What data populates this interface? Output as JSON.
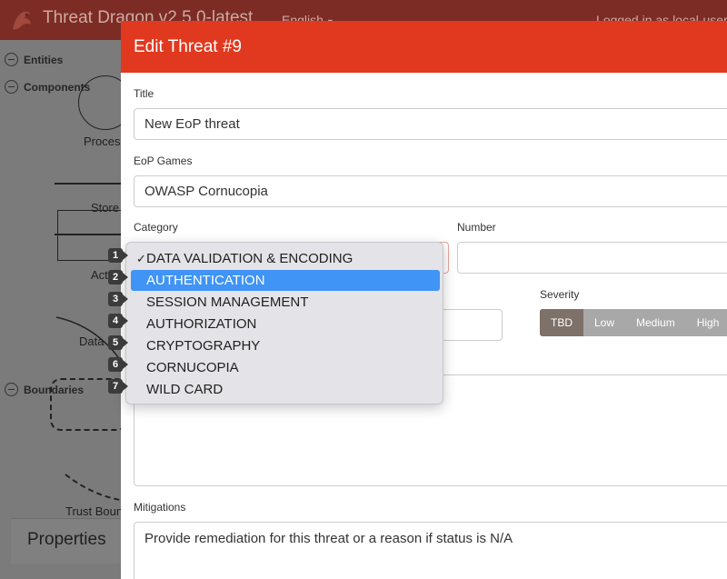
{
  "app": {
    "title": "Threat Dragon v2.5.0-latest",
    "language": "English",
    "login": "Logged in as local-user"
  },
  "sidebar": {
    "sections": [
      {
        "label": "Entities"
      },
      {
        "label": "Components"
      },
      {
        "label": "Boundaries"
      }
    ],
    "shapes": {
      "process": "Proces",
      "store": "Store",
      "actor": "Act",
      "dataflow": "Data",
      "boundary": "Trust Boun"
    },
    "properties": "Properties"
  },
  "modal": {
    "title": "Edit Threat #9",
    "fields": {
      "title_label": "Title",
      "title_value": "New EoP threat",
      "games_label": "EoP Games",
      "games_value": "OWASP Cornucopia",
      "category_label": "Category",
      "number_label": "Number",
      "number_value": "",
      "severity_label": "Severity",
      "mitigations_label": "Mitigations",
      "mitigations_value": "Provide remediation for this threat or a reason if status is N/A"
    },
    "severity_options": [
      "TBD",
      "Low",
      "Medium",
      "High"
    ],
    "severity_selected": "TBD"
  },
  "dropdown": {
    "checked": "DATA VALIDATION & ENCODING",
    "highlighted": "AUTHENTICATION",
    "options": [
      "DATA VALIDATION & ENCODING",
      "AUTHENTICATION",
      "SESSION MANAGEMENT",
      "AUTHORIZATION",
      "CRYPTOGRAPHY",
      "CORNUCOPIA",
      "WILD CARD"
    ],
    "badges": [
      "1",
      "2",
      "3",
      "4",
      "5",
      "6",
      "7"
    ]
  },
  "colors": {
    "header_red": "#e0391f",
    "selected_blue": "#3f94f5",
    "severity_active": "#7e7169"
  },
  "icons": {
    "logo": "dragon-logo-icon",
    "collapse": "collapse-circle-icon",
    "checkmark": "checkmark-icon"
  }
}
